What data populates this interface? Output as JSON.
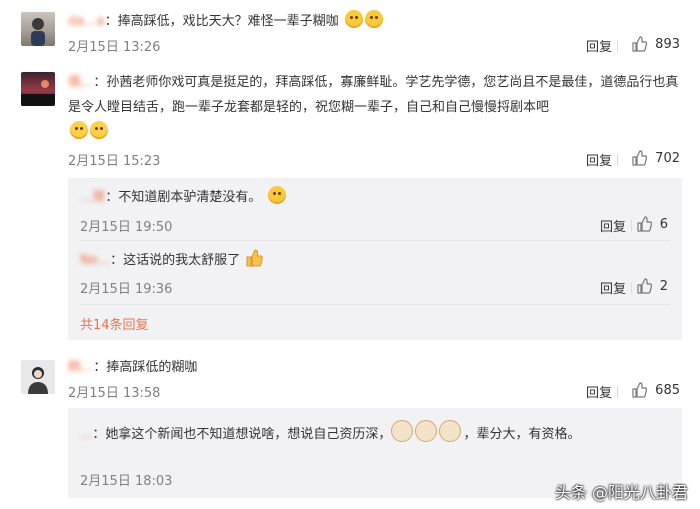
{
  "comments": [
    {
      "username": "da...a",
      "text": "捧高踩低，戏比天大？难怪一辈子糊咖",
      "emoji_count": 2,
      "time": "2月15日 13:26",
      "reply_label": "回复",
      "likes": "893"
    },
    {
      "username": "俄...",
      "text": "孙茜老师你戏可真是挺足的，拜高踩低，寡廉鲜耻。学艺先学德，您艺尚且不是最佳，道德品行也真是令人瞠目结舌，跑一辈子龙套都是轻的，祝您糊一辈子，自己和自己慢慢捋剧本吧",
      "time": "2月15日 15:23",
      "reply_label": "回复",
      "likes": "702",
      "replies": [
        {
          "username": "...哥",
          "text": "不知道剧本驴清楚没有。",
          "time": "2月15日 19:50",
          "reply_label": "回复",
          "likes": "6"
        },
        {
          "username": "Ne...",
          "text": "这话说的我太舒服了",
          "time": "2月15日 19:36",
          "reply_label": "回复",
          "likes": "2"
        }
      ],
      "more_replies": "共14条回复"
    },
    {
      "username": "韩...",
      "text": "捧高踩低的糊咖",
      "time": "2月15日 13:58",
      "reply_label": "回复",
      "likes": "685",
      "replies": [
        {
          "username": "...",
          "text_before": "她拿这个新闻也不知道想说啥，想说自己资历深，",
          "text_after": "，辈分大，有资格。",
          "time": "2月15日 18:03"
        }
      ]
    }
  ],
  "watermark": "头条 @阳光八卦君",
  "colors": {
    "username": "#eb7350",
    "meta": "#808080",
    "reply_box": "#f2f2f5"
  }
}
